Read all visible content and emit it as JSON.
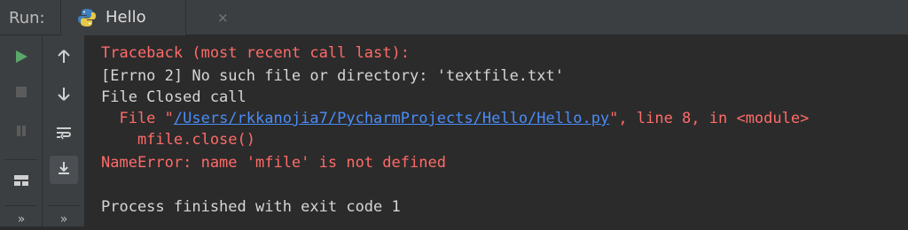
{
  "header": {
    "run_label": "Run:",
    "tab": {
      "title": "Hello",
      "close": "×"
    }
  },
  "icons": {
    "left": [
      "play-icon",
      "stop-icon",
      "pause-icon",
      "layout-icon",
      "more-icon"
    ],
    "mid": [
      "arrow-up-icon",
      "arrow-down-icon",
      "soft-wrap-icon",
      "scroll-to-end-icon",
      "more-icon"
    ]
  },
  "console": {
    "line1": "Traceback (most recent call last):",
    "line2": "[Errno 2] No such file or directory: 'textfile.txt'",
    "line3": "File Closed call",
    "line4_prefix": "  File \"",
    "line4_link": "/Users/rkkanojia7/PycharmProjects/Hello/Hello.py",
    "line4_suffix": "\", line 8, in <module>",
    "line5": "    mfile.close()",
    "line6": "NameError: name 'mfile' is not defined",
    "line7": "Process finished with exit code 1"
  },
  "colors": {
    "error": "#ff6b68",
    "normal": "#d6d6d6",
    "link": "#4a8cf7",
    "run_green": "#59a869"
  }
}
